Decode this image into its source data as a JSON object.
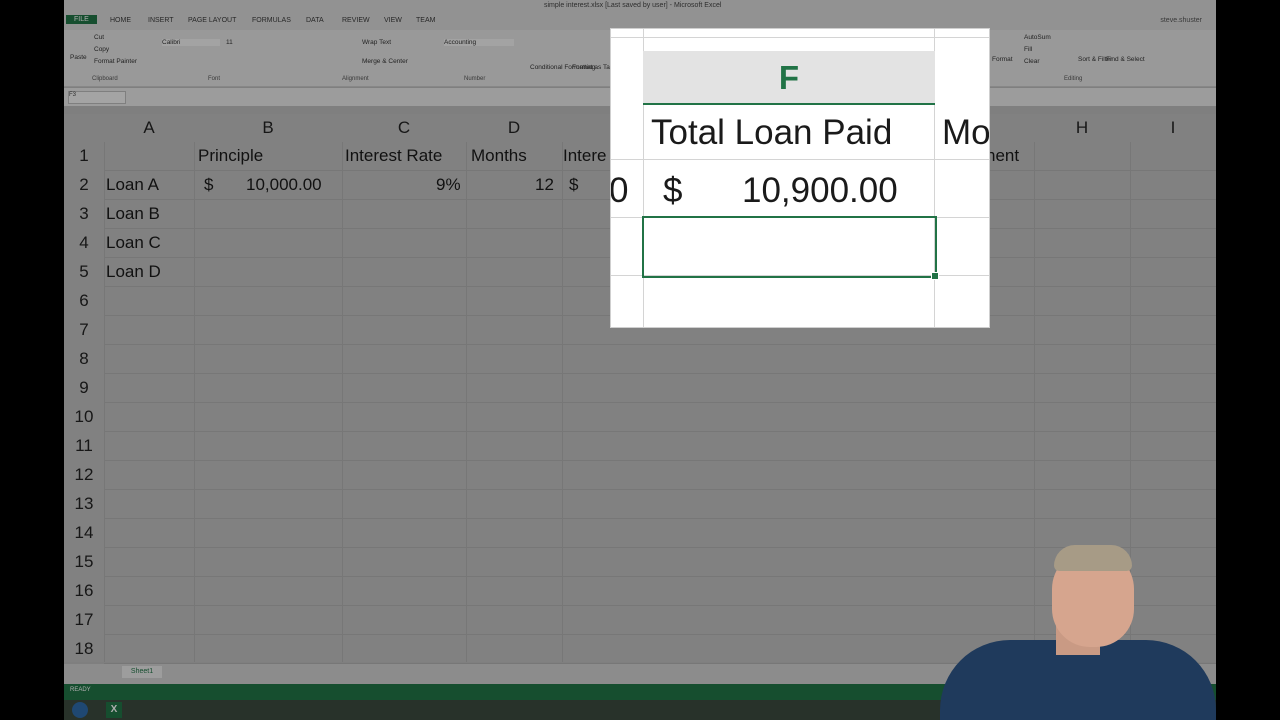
{
  "window": {
    "title": "simple interest.xlsx [Last saved by user] - Microsoft Excel",
    "user": "steve.shuster"
  },
  "ribbon_tabs": [
    "FILE",
    "HOME",
    "INSERT",
    "PAGE LAYOUT",
    "FORMULAS",
    "DATA",
    "REVIEW",
    "VIEW",
    "TEAM"
  ],
  "ribbon": {
    "cut": "Cut",
    "copy": "Copy",
    "format_painter": "Format Painter",
    "paste": "Paste",
    "font_name": "Calibri",
    "font_size": "11",
    "wrap_text": "Wrap Text",
    "merge_center": "Merge & Center",
    "number_format": "Accounting",
    "conditional_formatting": "Conditional Formatting",
    "format_as_table": "Format as Table",
    "format": "Format",
    "autosum": "AutoSum",
    "fill": "Fill",
    "clear": "Clear",
    "sort_filter": "Sort & Filter",
    "find_select": "Find & Select",
    "groups": [
      "Clipboard",
      "Font",
      "Alignment",
      "Number",
      "Editing"
    ]
  },
  "formula_bar": {
    "name_box": "F3"
  },
  "columns": [
    "A",
    "B",
    "C",
    "D",
    "H",
    "I"
  ],
  "rows": [
    "1",
    "2",
    "3",
    "4",
    "5",
    "6",
    "7",
    "8",
    "9",
    "10",
    "11",
    "12",
    "13",
    "14",
    "15",
    "16",
    "17",
    "18"
  ],
  "cells": {
    "b1": "Principle",
    "c1": "Interest Rate",
    "d1": "Months",
    "e1_partial": "Intere",
    "g1_partial": "nent",
    "a2": "Loan A",
    "b2_currency": "$",
    "b2": "10,000.00",
    "c2": "9%",
    "d2": "12",
    "e2_currency": "$",
    "a3": "Loan B",
    "a4": "Loan C",
    "a5": "Loan D"
  },
  "zoom_callout": {
    "column": "F",
    "header": "Total Loan Paid",
    "next_header_partial": "Mo",
    "prev_value_partial": "0",
    "currency": "$",
    "value": "10,900.00"
  },
  "sheet_tab": "Sheet1",
  "status": "READY"
}
